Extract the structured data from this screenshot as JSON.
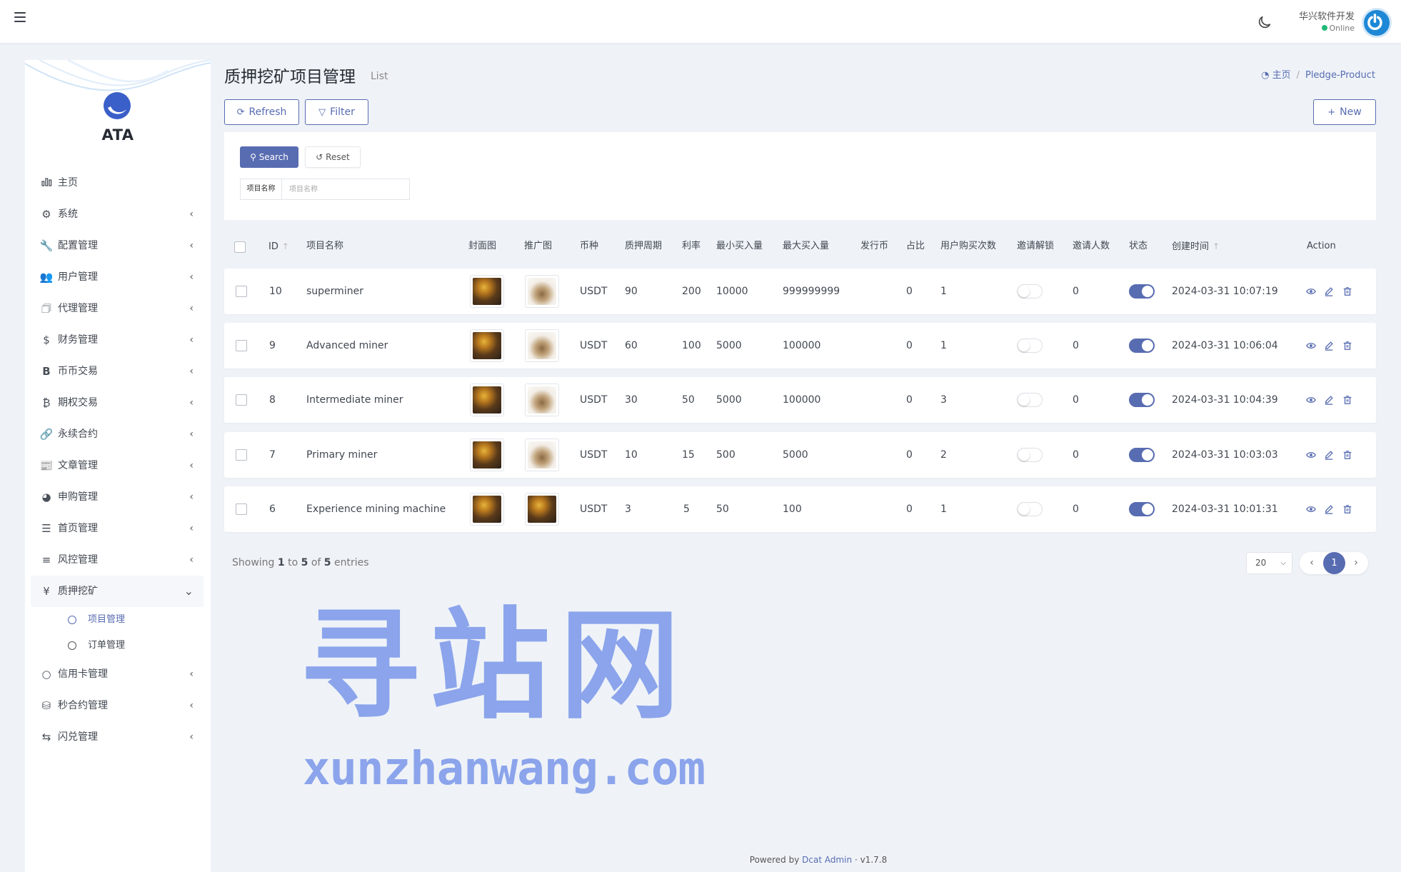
{
  "header": {
    "user_name": "华兴软件开发",
    "user_status": "Online"
  },
  "sidebar": {
    "logo_text": "ATA",
    "items": [
      {
        "label": "主页",
        "icon": "bar-chart-icon",
        "has_children": false
      },
      {
        "label": "系统",
        "icon": "gear-icon",
        "has_children": true
      },
      {
        "label": "配置管理",
        "icon": "wrench-icon",
        "has_children": true
      },
      {
        "label": "用户管理",
        "icon": "users-icon",
        "has_children": true
      },
      {
        "label": "代理管理",
        "icon": "id-card-icon",
        "has_children": true
      },
      {
        "label": "财务管理",
        "icon": "dollar-icon",
        "has_children": true
      },
      {
        "label": "币币交易",
        "icon": "bitcoin-b-icon",
        "has_children": true
      },
      {
        "label": "期权交易",
        "icon": "bitcoin-icon",
        "has_children": true
      },
      {
        "label": "永续合约",
        "icon": "link-icon",
        "has_children": true
      },
      {
        "label": "文章管理",
        "icon": "newspaper-icon",
        "has_children": true
      },
      {
        "label": "申购管理",
        "icon": "life-ring-icon",
        "has_children": true
      },
      {
        "label": "首页管理",
        "icon": "list-icon",
        "has_children": true
      },
      {
        "label": "风控管理",
        "icon": "indent-icon",
        "has_children": true
      },
      {
        "label": "质押挖矿",
        "icon": "yen-icon",
        "has_children": true,
        "open": true,
        "children": [
          {
            "label": "项目管理",
            "active": true
          },
          {
            "label": "订单管理",
            "active": false
          }
        ]
      },
      {
        "label": "信用卡管理",
        "icon": "circle-icon",
        "has_children": true
      },
      {
        "label": "秒合约管理",
        "icon": "coins-icon",
        "has_children": true
      },
      {
        "label": "闪兑管理",
        "icon": "exchange-icon",
        "has_children": true
      }
    ]
  },
  "page": {
    "title": "质押挖矿项目管理",
    "subtitle": "List",
    "breadcrumb_home": "主页",
    "breadcrumb_current": "Pledge-Product"
  },
  "toolbar": {
    "refresh_label": "Refresh",
    "filter_label": "Filter",
    "new_label": "New"
  },
  "filter": {
    "search_label": "Search",
    "reset_label": "Reset",
    "field_label": "项目名称",
    "field_placeholder": "项目名称"
  },
  "table": {
    "columns": [
      "ID",
      "项目名称",
      "封面图",
      "推广图",
      "币种",
      "质押周期",
      "利率",
      "最小买入量",
      "最大买入量",
      "发行币",
      "占比",
      "用户购买次数",
      "邀请解锁",
      "邀请人数",
      "状态",
      "创建时间",
      "Action"
    ],
    "rows": [
      {
        "id": "10",
        "name": "superminer",
        "cover": "dark",
        "promo": "light",
        "coin": "USDT",
        "period": "90",
        "rate": "200",
        "min": "10000",
        "max": "999999999",
        "issue": "",
        "ratio": "0",
        "buys": "1",
        "invite_unlock": false,
        "invites": "0",
        "status": true,
        "created": "2024-03-31 10:07:19"
      },
      {
        "id": "9",
        "name": "Advanced miner",
        "cover": "dark",
        "promo": "light",
        "coin": "USDT",
        "period": "60",
        "rate": "100",
        "min": "5000",
        "max": "100000",
        "issue": "",
        "ratio": "0",
        "buys": "1",
        "invite_unlock": false,
        "invites": "0",
        "status": true,
        "created": "2024-03-31 10:06:04"
      },
      {
        "id": "8",
        "name": "Intermediate miner",
        "cover": "dark",
        "promo": "light",
        "coin": "USDT",
        "period": "30",
        "rate": "50",
        "min": "5000",
        "max": "100000",
        "issue": "",
        "ratio": "0",
        "buys": "3",
        "invite_unlock": false,
        "invites": "0",
        "status": true,
        "created": "2024-03-31 10:04:39"
      },
      {
        "id": "7",
        "name": "Primary miner",
        "cover": "dark",
        "promo": "light",
        "coin": "USDT",
        "period": "10",
        "rate": "15",
        "min": "500",
        "max": "5000",
        "issue": "",
        "ratio": "0",
        "buys": "2",
        "invite_unlock": false,
        "invites": "0",
        "status": true,
        "created": "2024-03-31 10:03:03"
      },
      {
        "id": "6",
        "name": "Experience mining machine",
        "cover": "dark",
        "promo": "dark",
        "coin": "USDT",
        "period": "3",
        "rate": "5",
        "min": "50",
        "max": "100",
        "issue": "",
        "ratio": "0",
        "buys": "1",
        "invite_unlock": false,
        "invites": "0",
        "status": true,
        "created": "2024-03-31 10:01:31"
      }
    ]
  },
  "pagination": {
    "showing_prefix": "Showing",
    "from": "1",
    "to_word": "to",
    "to": "5",
    "of_word": "of",
    "total": "5",
    "entries_word": "entries",
    "per_page": "20",
    "current_page": "1"
  },
  "watermark": {
    "line1": "寻站网",
    "line2": "xunzhanwang.com"
  },
  "footer": {
    "powered_by": "Powered by",
    "link": "Dcat Admin",
    "version": "v1.7.8"
  },
  "colors": {
    "primary": "#586cb1",
    "online": "#21b978"
  }
}
